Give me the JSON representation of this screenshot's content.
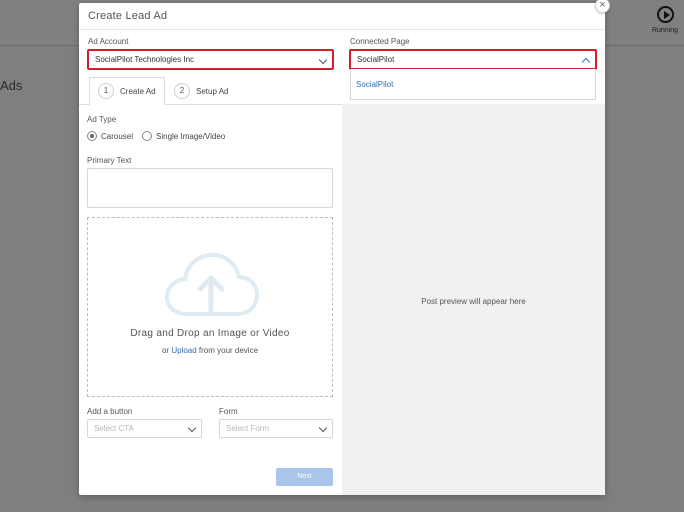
{
  "background": {
    "page_title": "Ads",
    "running_label": "Running"
  },
  "modal": {
    "title": "Create Lead Ad",
    "close_glyph": "×",
    "ad_account": {
      "label": "Ad Account",
      "value": "SocialPilot Technologies Inc"
    },
    "connected_page": {
      "label": "Connected Page",
      "value": "SocialPilot",
      "options": [
        "SocialPilot"
      ]
    },
    "tabs": [
      {
        "step": "1",
        "label": "Create Ad"
      },
      {
        "step": "2",
        "label": "Setup Ad"
      }
    ],
    "ad_type": {
      "label": "Ad Type",
      "options": [
        "Carousel",
        "Single Image/Video"
      ],
      "selected": "Carousel"
    },
    "primary_text": {
      "label": "Primary Text",
      "value": ""
    },
    "dropzone": {
      "main_text": "Drag and Drop an Image or Video",
      "prefix": "or ",
      "link_text": "Upload",
      "suffix": " from your device"
    },
    "add_button": {
      "label": "Add a button",
      "placeholder": "Select CTA"
    },
    "form": {
      "label": "Form",
      "placeholder": "Select Form"
    },
    "next_label": "Next",
    "preview_text": "Post preview will appear here"
  },
  "colors": {
    "highlight": "#d61d2a",
    "link": "#2f6fb3",
    "primary_disabled": "#a9c6ea"
  }
}
